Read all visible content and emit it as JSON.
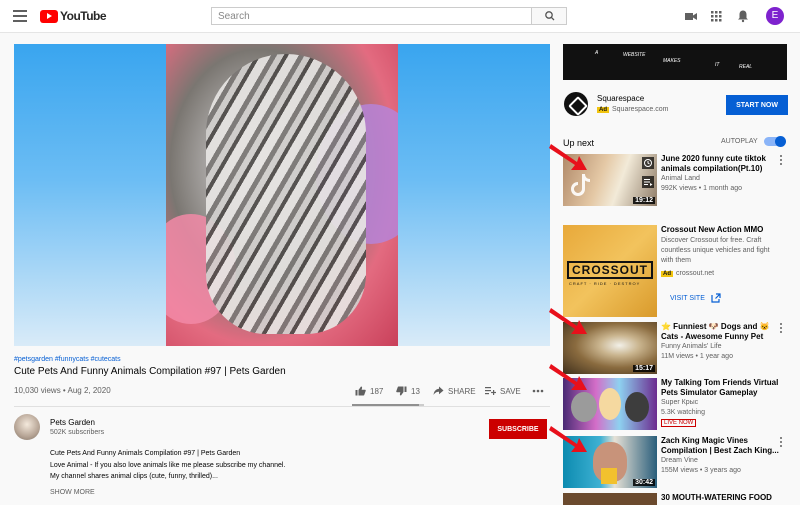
{
  "header": {
    "logo_text": "YouTube",
    "search_placeholder": "Search",
    "avatar_letter": "E",
    "icons": [
      "menu-icon",
      "search-icon",
      "video-camera-icon",
      "apps-icon",
      "bell-icon"
    ]
  },
  "video": {
    "hashtags": "#petsgarden #funnycats #cutecats",
    "title": "Cute Pets And Funny Animals Compilation #97 | Pets Garden",
    "meta": "10,030 views • Aug 2, 2020",
    "likes": "187",
    "dislikes": "13",
    "share_label": "SHARE",
    "save_label": "SAVE",
    "like_ratio": 0.93
  },
  "channel": {
    "name": "Pets Garden",
    "subscribers": "502K subscribers",
    "subscribe_label": "SUBSCRIBE",
    "description": [
      "Cute Pets And Funny Animals Compilation #97 | Pets Garden",
      "Love Animal - If you also love animals like me please subscribe my channel.",
      "My channel shares animal clips (cute, funny, thrilled)..."
    ],
    "show_more_label": "SHOW MORE"
  },
  "ad": {
    "banner_words": [
      "A",
      "WEBSITE",
      "MAKES",
      "IT",
      "REAL"
    ],
    "advertiser": "Squarespace",
    "badge": "Ad",
    "url": "Squarespace.com",
    "cta": "START NOW"
  },
  "sidebar": {
    "up_next_label": "Up next",
    "autoplay_label": "AUTOPLAY",
    "autoplay_on": true
  },
  "recommendations": [
    {
      "title": "June 2020 funny cute tiktok animals compilation(Pt.10)",
      "channel": "Animal Land",
      "meta": "992K views • 1 month ago",
      "duration": "19:12"
    },
    {
      "title": "⭐ Funniest 🐶 Dogs and 😺 Cats - Awesome Funny Pet Animals...",
      "channel": "Funny Animals' Life",
      "meta": "11M views • 1 year ago",
      "duration": "15:17"
    },
    {
      "title": "My Talking Tom Friends Virtual Pets Simulator Gameplay",
      "channel": "Super Крыс",
      "meta": "5.3K watching",
      "live_label": "LIVE NOW"
    },
    {
      "title": "Zach King Magic Vines Compilation | Best Zach King...",
      "channel": "Dream Vine",
      "meta": "155M views • 3 years ago",
      "duration": "30:42"
    },
    {
      "title": "30 MOUTH-WATERING FOOD"
    }
  ],
  "crossout_ad": {
    "title": "Crossout New Action MMO",
    "description": "Discover Crossout for free. Craft countless unique vehicles and fight with them",
    "badge": "Ad",
    "url": "crossout.net",
    "cta": "VISIT SITE",
    "logo_text": "CROSSOUT",
    "tagline": "CRAFT · RIDE · DESTROY"
  },
  "colors": {
    "brand_red": "#ff0000",
    "subscribe_red": "#cc0000",
    "link_blue": "#065fd4",
    "arrow_red": "#e8101b"
  }
}
